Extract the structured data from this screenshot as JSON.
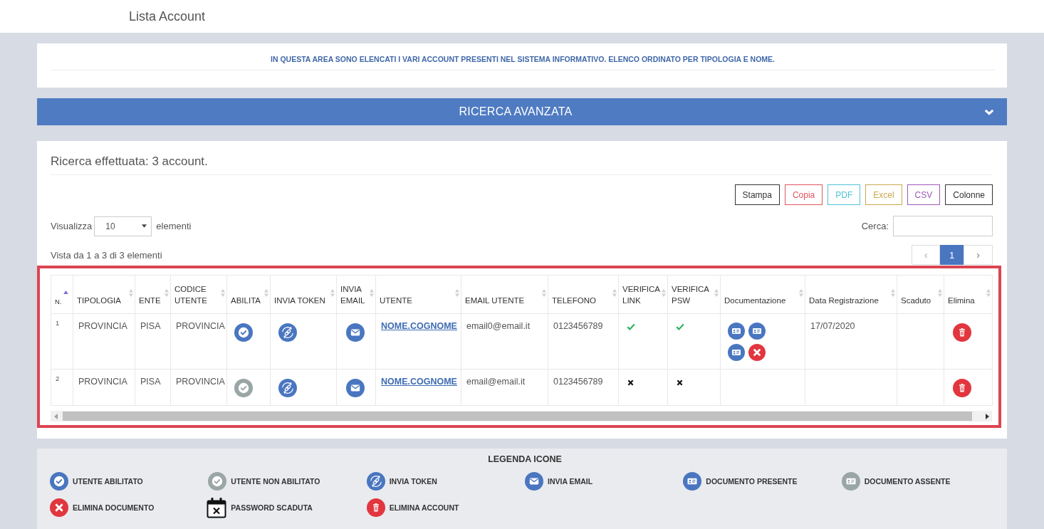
{
  "page_header": {
    "title": "Lista Account"
  },
  "info_panel": {
    "text": "IN QUESTA AREA SONO ELENCATI I VARI ACCOUNT PRESENTI NEL SISTEMA INFORMATIVO. ELENCO ORDINATO PER TIPOLOGIA E NOME."
  },
  "advanced_search": {
    "label": "RICERCA AVANZATA"
  },
  "results": {
    "title": "Ricerca effettuata: 3 account.",
    "export_buttons": [
      {
        "label": "Stampa",
        "color": "#333333"
      },
      {
        "label": "Copia",
        "color": "#e05560"
      },
      {
        "label": "PDF",
        "color": "#4fc3d9"
      },
      {
        "label": "Excel",
        "color": "#c9a94e"
      },
      {
        "label": "CSV",
        "color": "#9b59b6"
      },
      {
        "label": "Colonne",
        "color": "#333333"
      }
    ],
    "page_length": {
      "label": "Visualizza",
      "value": "10",
      "suffix": "elementi"
    },
    "search": {
      "label": "Cerca:"
    },
    "info": "Vista da 1 a 3 di 3 elementi",
    "pagination": {
      "previous": "‹",
      "pages": [
        {
          "label": "1",
          "selected": true
        }
      ],
      "next": "›"
    },
    "table": {
      "columns": [
        {
          "label": "N.",
          "sorted": true
        },
        {
          "label": "TIPOLOGIA",
          "sorted": false
        },
        {
          "label": "ENTE",
          "sorted": false
        },
        {
          "label": "CODICE UTENTE",
          "sorted": false
        },
        {
          "label": "ABILITA",
          "sorted": false
        },
        {
          "label": "INVIA TOKEN",
          "sorted": false
        },
        {
          "label": "INVIA EMAIL",
          "sorted": false
        },
        {
          "label": "UTENTE",
          "sorted": false
        },
        {
          "label": "EMAIL UTENTE",
          "sorted": false
        },
        {
          "label": "TELEFONO",
          "sorted": false
        },
        {
          "label": "VERIFICA LINK",
          "sorted": false
        },
        {
          "label": "VERIFICA PSW",
          "sorted": false
        },
        {
          "label": "Documentazione",
          "sorted": false
        },
        {
          "label": "Data Registrazione",
          "sorted": false
        },
        {
          "label": "Scaduto",
          "sorted": false
        },
        {
          "label": "Elimina",
          "sorted": false
        }
      ],
      "rows": [
        {
          "number": "1",
          "type": "PROVINCIA",
          "entity": "PISA",
          "user_code": "PROVINCIA",
          "enabled": true,
          "username": "NOME.COGNOME",
          "email": "email0@email.it",
          "phone": "0123456789",
          "link_verified": true,
          "password_verified": true,
          "documents": [
            {
              "kind": "document-present"
            },
            {
              "kind": "document-present"
            },
            {
              "kind": "document-present"
            },
            {
              "kind": "document-delete"
            }
          ],
          "registration_date": "17/07/2020"
        },
        {
          "number": "2",
          "type": "PROVINCIA",
          "entity": "PISA",
          "user_code": "PROVINCIA",
          "enabled": false,
          "username": "NOME.COGNOME",
          "email": "email@email.it",
          "phone": "0123456789",
          "link_verified": false,
          "password_verified": false
        }
      ]
    }
  },
  "legend": {
    "title": "LEGENDA ICONE",
    "items": [
      {
        "kind": "user-enabled",
        "label": "UTENTE ABILITATO"
      },
      {
        "kind": "user-disabled",
        "label": "UTENTE NON ABILITATO"
      },
      {
        "kind": "token",
        "label": "INVIA TOKEN"
      },
      {
        "kind": "email",
        "label": "INVIA EMAIL"
      },
      {
        "kind": "document-present",
        "label": "DOCUMENTO PRESENTE"
      },
      {
        "kind": "document-absent",
        "label": "DOCUMENTO ASSENTE"
      },
      {
        "kind": "document-delete",
        "label": "ELIMINA DOCUMENTO"
      },
      {
        "kind": "password-expired",
        "label": "PASSWORD SCADUTA"
      },
      {
        "kind": "account-delete",
        "label": "ELIMINA ACCOUNT"
      }
    ]
  }
}
